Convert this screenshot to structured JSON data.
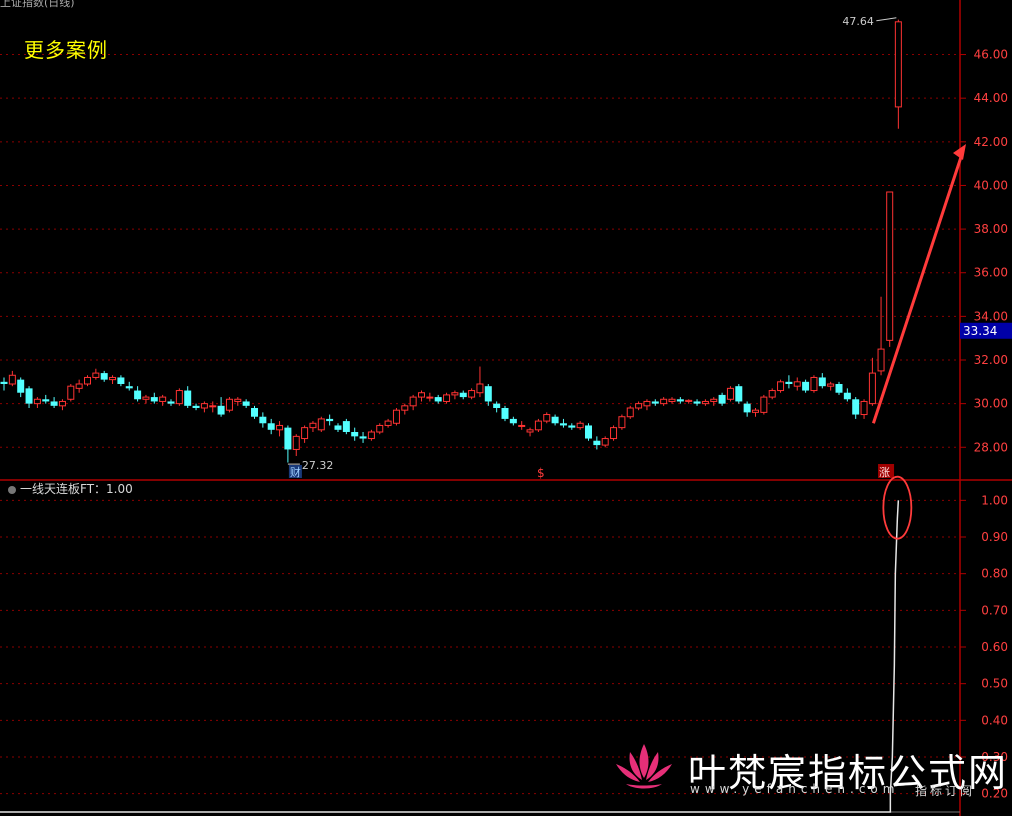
{
  "header": {
    "top_left_title": "上证指数(日线)",
    "cases_label": "更多案例"
  },
  "indicator": {
    "label": "一线天连板FT：1.00",
    "ylim": [
      0.15,
      1.05
    ],
    "ticks": [
      "1.00",
      "0.90",
      "0.80",
      "0.70",
      "0.60",
      "0.50",
      "0.40",
      "0.30",
      "0.20"
    ]
  },
  "price_axis": {
    "ticks": [
      "46.00",
      "44.00",
      "42.00",
      "40.00",
      "38.00",
      "36.00",
      "34.00",
      "32.00",
      "30.00",
      "28.00"
    ],
    "current": "33.34"
  },
  "markers": {
    "high": "47.64",
    "low": "27.32",
    "cai": "财",
    "dollar": "$",
    "zhang": "涨"
  },
  "watermark": {
    "name": "叶梵宸指标公式网",
    "url": "www.yefanchen.com",
    "sub": "指标订阅"
  },
  "colors": {
    "up": "#ff3333",
    "down": "#54ffff",
    "grid": "#8b0000",
    "axis_text": "#ff4040",
    "annotation": "#ff3b3b",
    "indicator_line": "#e6e6e6",
    "cases": "#ffff00",
    "current_box": "#0000a8"
  },
  "chart_data": {
    "type": "candlestick",
    "ylim": [
      26.5,
      48.5
    ],
    "candles": [
      [
        31.0,
        31.2,
        30.6,
        30.9
      ],
      [
        30.9,
        31.5,
        30.8,
        31.3
      ],
      [
        31.1,
        31.2,
        30.3,
        30.5
      ],
      [
        30.7,
        30.8,
        29.8,
        30.0
      ],
      [
        30.0,
        30.3,
        29.8,
        30.2
      ],
      [
        30.2,
        30.4,
        30.0,
        30.1
      ],
      [
        30.1,
        30.3,
        29.8,
        29.9
      ],
      [
        29.9,
        30.2,
        29.7,
        30.1
      ],
      [
        30.2,
        30.9,
        30.1,
        30.8
      ],
      [
        30.7,
        31.1,
        30.5,
        30.9
      ],
      [
        30.9,
        31.3,
        30.8,
        31.2
      ],
      [
        31.2,
        31.6,
        31.1,
        31.4
      ],
      [
        31.4,
        31.5,
        31.0,
        31.1
      ],
      [
        31.1,
        31.3,
        30.9,
        31.2
      ],
      [
        31.2,
        31.3,
        30.8,
        30.9
      ],
      [
        30.8,
        31.0,
        30.6,
        30.7
      ],
      [
        30.6,
        30.8,
        30.1,
        30.2
      ],
      [
        30.2,
        30.4,
        30.0,
        30.3
      ],
      [
        30.3,
        30.5,
        30.0,
        30.1
      ],
      [
        30.1,
        30.4,
        29.9,
        30.3
      ],
      [
        30.1,
        30.2,
        29.9,
        30.0
      ],
      [
        30.0,
        30.7,
        29.9,
        30.6
      ],
      [
        30.6,
        30.8,
        29.8,
        29.9
      ],
      [
        29.9,
        30.0,
        29.7,
        29.8
      ],
      [
        29.8,
        30.1,
        29.6,
        30.0
      ],
      [
        29.9,
        30.1,
        29.6,
        29.9
      ],
      [
        29.9,
        30.3,
        29.4,
        29.5
      ],
      [
        29.7,
        30.3,
        29.6,
        30.2
      ],
      [
        30.1,
        30.3,
        29.9,
        30.2
      ],
      [
        30.1,
        30.2,
        29.8,
        29.9
      ],
      [
        29.8,
        29.9,
        29.3,
        29.4
      ],
      [
        29.4,
        29.6,
        28.9,
        29.1
      ],
      [
        29.1,
        29.3,
        28.6,
        28.8
      ],
      [
        28.8,
        29.2,
        28.5,
        29.0
      ],
      [
        28.9,
        29.0,
        27.3,
        27.9
      ],
      [
        27.9,
        28.6,
        27.6,
        28.5
      ],
      [
        28.4,
        29.0,
        28.2,
        28.9
      ],
      [
        28.9,
        29.2,
        28.7,
        29.1
      ],
      [
        28.8,
        29.4,
        28.7,
        29.3
      ],
      [
        29.3,
        29.5,
        29.0,
        29.2
      ],
      [
        29.0,
        29.1,
        28.7,
        28.8
      ],
      [
        29.2,
        29.3,
        28.6,
        28.7
      ],
      [
        28.7,
        28.9,
        28.3,
        28.5
      ],
      [
        28.5,
        28.7,
        28.2,
        28.4
      ],
      [
        28.4,
        28.8,
        28.3,
        28.7
      ],
      [
        28.7,
        29.1,
        28.6,
        29.0
      ],
      [
        29.0,
        29.3,
        28.9,
        29.2
      ],
      [
        29.1,
        29.8,
        29.0,
        29.7
      ],
      [
        29.7,
        30.0,
        29.5,
        29.9
      ],
      [
        29.9,
        30.4,
        29.7,
        30.3
      ],
      [
        30.3,
        30.6,
        30.1,
        30.5
      ],
      [
        30.3,
        30.5,
        30.1,
        30.3
      ],
      [
        30.3,
        30.4,
        30.0,
        30.1
      ],
      [
        30.1,
        30.5,
        30.0,
        30.4
      ],
      [
        30.4,
        30.6,
        30.2,
        30.5
      ],
      [
        30.5,
        30.6,
        30.2,
        30.3
      ],
      [
        30.3,
        30.7,
        30.2,
        30.6
      ],
      [
        30.5,
        31.7,
        30.3,
        30.9
      ],
      [
        30.8,
        30.9,
        29.9,
        30.1
      ],
      [
        30.0,
        30.1,
        29.6,
        29.8
      ],
      [
        29.8,
        29.9,
        29.2,
        29.3
      ],
      [
        29.3,
        29.4,
        29.0,
        29.1
      ],
      [
        29.0,
        29.2,
        28.8,
        29.0
      ],
      [
        28.7,
        28.9,
        28.5,
        28.8
      ],
      [
        28.8,
        29.3,
        28.7,
        29.2
      ],
      [
        29.2,
        29.6,
        29.1,
        29.5
      ],
      [
        29.4,
        29.5,
        29.0,
        29.1
      ],
      [
        29.1,
        29.3,
        28.9,
        29.0
      ],
      [
        29.0,
        29.1,
        28.8,
        28.9
      ],
      [
        28.9,
        29.2,
        28.8,
        29.1
      ],
      [
        29.0,
        29.1,
        28.3,
        28.4
      ],
      [
        28.3,
        28.5,
        27.9,
        28.1
      ],
      [
        28.1,
        28.5,
        28.0,
        28.4
      ],
      [
        28.4,
        29.0,
        28.3,
        28.9
      ],
      [
        28.9,
        29.5,
        28.8,
        29.4
      ],
      [
        29.4,
        29.9,
        29.3,
        29.8
      ],
      [
        29.8,
        30.1,
        29.7,
        30.0
      ],
      [
        29.9,
        30.2,
        29.7,
        30.1
      ],
      [
        30.1,
        30.2,
        29.9,
        30.0
      ],
      [
        30.0,
        30.3,
        29.9,
        30.2
      ],
      [
        30.1,
        30.3,
        30.0,
        30.2
      ],
      [
        30.2,
        30.3,
        30.0,
        30.1
      ],
      [
        30.1,
        30.2,
        30.0,
        30.15
      ],
      [
        30.1,
        30.2,
        29.9,
        30.0
      ],
      [
        30.0,
        30.2,
        29.9,
        30.1
      ],
      [
        30.1,
        30.3,
        29.9,
        30.2
      ],
      [
        30.4,
        30.5,
        29.9,
        30.0
      ],
      [
        30.2,
        30.8,
        30.1,
        30.7
      ],
      [
        30.8,
        30.9,
        30.0,
        30.1
      ],
      [
        30.0,
        30.1,
        29.4,
        29.6
      ],
      [
        29.6,
        29.8,
        29.4,
        29.7
      ],
      [
        29.6,
        30.4,
        29.5,
        30.3
      ],
      [
        30.3,
        30.7,
        30.2,
        30.6
      ],
      [
        30.6,
        31.1,
        30.5,
        31.0
      ],
      [
        31.0,
        31.3,
        30.7,
        30.9
      ],
      [
        30.8,
        31.2,
        30.6,
        31.0
      ],
      [
        31.0,
        31.1,
        30.5,
        30.6
      ],
      [
        30.6,
        31.3,
        30.5,
        31.2
      ],
      [
        31.2,
        31.4,
        30.7,
        30.8
      ],
      [
        30.8,
        31.0,
        30.6,
        30.9
      ],
      [
        30.9,
        31.0,
        30.4,
        30.5
      ],
      [
        30.5,
        30.7,
        30.1,
        30.2
      ],
      [
        30.2,
        30.3,
        29.3,
        29.5
      ],
      [
        29.5,
        30.2,
        29.3,
        30.1
      ],
      [
        30.0,
        32.1,
        29.9,
        31.4
      ],
      [
        31.5,
        34.9,
        31.3,
        32.5
      ],
      [
        32.9,
        39.7,
        32.6,
        39.7
      ],
      [
        43.6,
        47.6,
        42.6,
        47.5
      ]
    ]
  }
}
